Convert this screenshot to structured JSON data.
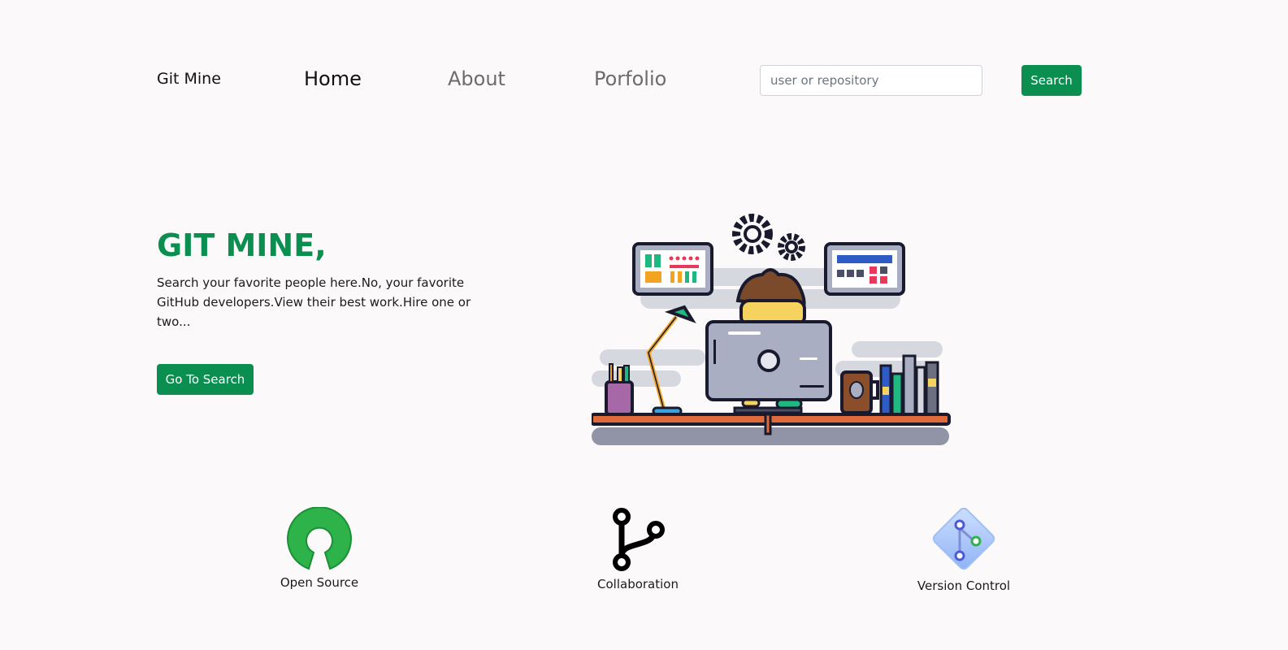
{
  "nav": {
    "brand": "Git Mine",
    "links": [
      {
        "label": "Home"
      },
      {
        "label": "About"
      },
      {
        "label": "Porfolio"
      }
    ],
    "search_placeholder": "user or repository",
    "search_button": "Search"
  },
  "hero": {
    "title": "GIT MINE,",
    "text": "Search your favorite people here.No, your favorite GitHub developers.View their best work.Hire one or two...",
    "cta_label": "Go To Search"
  },
  "features": [
    {
      "label": "Open Source",
      "icon": "open-source-icon"
    },
    {
      "label": "Collaboration",
      "icon": "git-branch-icon"
    },
    {
      "label": "Version Control",
      "icon": "version-control-icon"
    }
  ],
  "colors": {
    "accent": "#0a8f51",
    "background": "#fbf9fa",
    "nav_inactive": "#6c6c6c"
  }
}
